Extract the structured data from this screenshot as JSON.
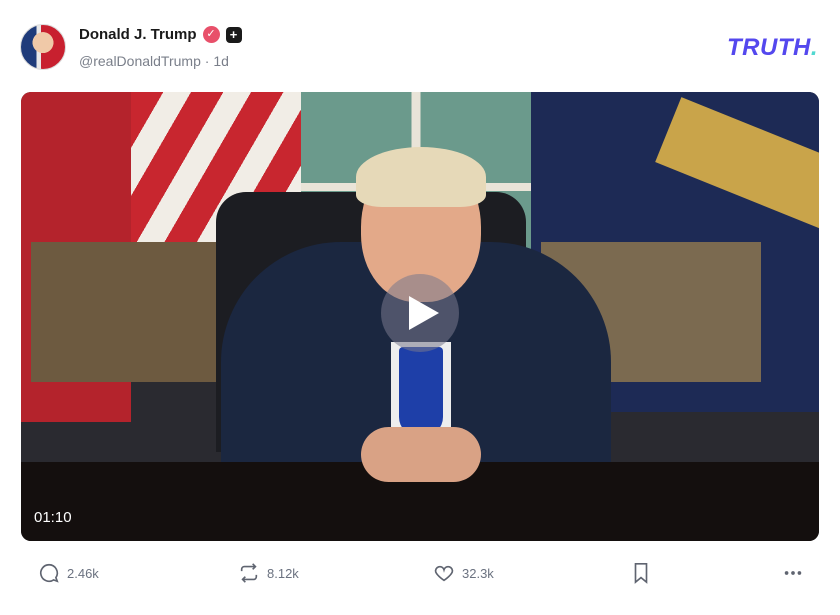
{
  "post": {
    "display_name": "Donald J. Trump",
    "handle": "@realDonaldTrump",
    "separator": "·",
    "age": "1d",
    "verified_icon": "verified-badge-icon",
    "plus_icon": "plus-badge-icon"
  },
  "brand": {
    "name": "TRUTH",
    "dot": ".",
    "color": "#5448ee",
    "dot_color": "#52d8d0"
  },
  "video": {
    "duration": "01:10",
    "play_icon": "play-icon"
  },
  "actions": {
    "replies": "2.46k",
    "retruths": "8.12k",
    "likes": "32.3k"
  },
  "colors": {
    "verified": "#e8506a",
    "muted_text": "#7a7f8a"
  }
}
